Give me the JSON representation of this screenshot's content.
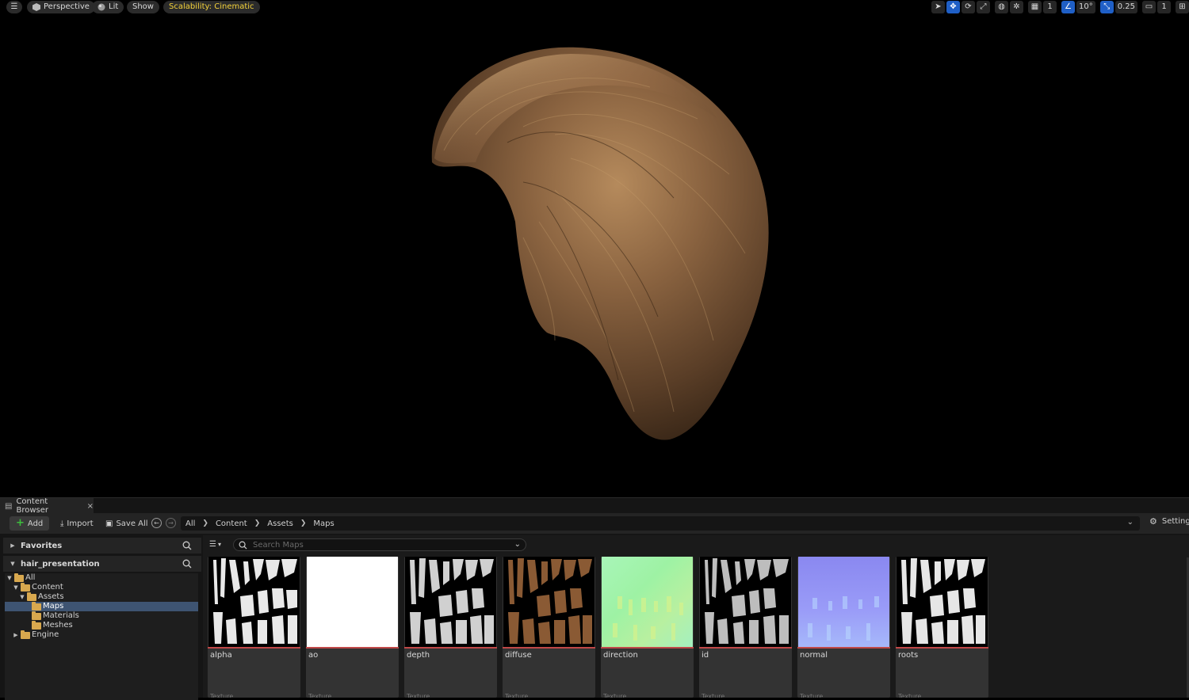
{
  "viewport": {
    "perspective_label": "Perspective",
    "lit_label": "Lit",
    "show_label": "Show",
    "scalability_label": "Scalability: Cinematic",
    "grid_snap_value": "1",
    "rotation_snap_value": "10°",
    "scale_snap_value": "0.25",
    "camera_speed_value": "1"
  },
  "content_browser": {
    "tab_title": "Content Browser",
    "add_label": "Add",
    "import_label": "Import",
    "save_all_label": "Save All",
    "breadcrumb": [
      "All",
      "Content",
      "Assets",
      "Maps"
    ],
    "settings_label": "Settings",
    "favorites_label": "Favorites",
    "project_label": "hair_presentation",
    "search_placeholder": "Search Maps",
    "tree": {
      "all": "All",
      "content": "Content",
      "assets": "Assets",
      "maps": "Maps",
      "materials": "Materials",
      "meshes": "Meshes",
      "engine": "Engine"
    },
    "assets": [
      {
        "name": "alpha",
        "type": "Texture"
      },
      {
        "name": "ao",
        "type": "Texture"
      },
      {
        "name": "depth",
        "type": "Texture"
      },
      {
        "name": "diffuse",
        "type": "Texture"
      },
      {
        "name": "direction",
        "type": "Texture"
      },
      {
        "name": "id",
        "type": "Texture"
      },
      {
        "name": "normal",
        "type": "Texture"
      },
      {
        "name": "roots",
        "type": "Texture"
      }
    ]
  },
  "colors": {
    "accent_blue": "#1f5fc6",
    "selection": "#3e5472",
    "folder": "#d8a84e",
    "scalability_text": "#f4d23a"
  }
}
